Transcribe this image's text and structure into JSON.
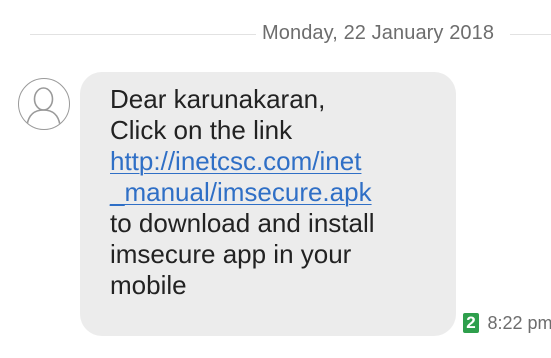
{
  "date_separator": "Monday, 22 January 2018",
  "message": {
    "lines": [
      "Dear karunakaran,",
      "Click on the link"
    ],
    "link_lines": [
      "http://inetcsc.com/inet",
      "_manual/imsecure.apk"
    ],
    "trailing_lines": [
      "to download and install",
      "imsecure app in your",
      "mobile"
    ],
    "sim_slot": "2",
    "time": "8:22 pm"
  },
  "icons": {
    "avatar": "person-avatar-icon"
  },
  "colors": {
    "bubble": "#ececec",
    "link": "#2f6fc6",
    "sim_badge": "#2e9f4c",
    "meta_text": "#6d6d6d"
  }
}
